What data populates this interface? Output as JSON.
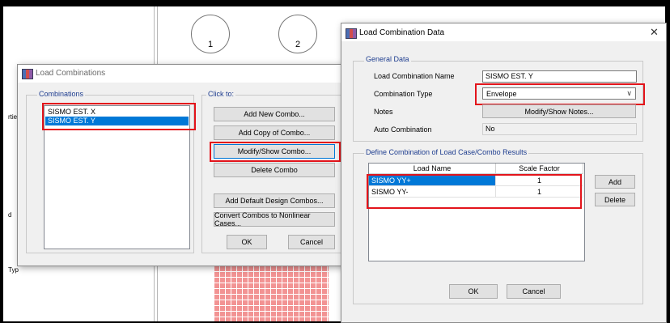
{
  "background": {
    "circles": [
      "1",
      "2"
    ],
    "side_labels": [
      "rtie",
      "d",
      "Typ"
    ]
  },
  "load_combinations": {
    "title": "Load Combinations",
    "combinations_label": "Combinations",
    "combinations": [
      "SISMO EST. X",
      "SISMO EST. Y"
    ],
    "selected_index": 1,
    "click_to_label": "Click to:",
    "buttons": {
      "add_new": "Add New Combo...",
      "add_copy": "Add Copy of Combo...",
      "modify_show": "Modify/Show Combo...",
      "delete": "Delete Combo",
      "add_default": "Add Default Design Combos...",
      "convert": "Convert Combos to Nonlinear Cases...",
      "ok": "OK",
      "cancel": "Cancel"
    }
  },
  "load_combination_data": {
    "title": "Load Combination Data",
    "close": "✕",
    "general_data_label": "General Data",
    "name_label": "Load Combination Name",
    "name_value": "SISMO EST. Y",
    "type_label": "Combination Type",
    "type_value": "Envelope",
    "notes_label": "Notes",
    "notes_button": "Modify/Show Notes...",
    "auto_label": "Auto Combination",
    "auto_value": "No",
    "define_label": "Define Combination of Load Case/Combo Results",
    "col_load_name": "Load Name",
    "col_scale_factor": "Scale Factor",
    "rows": [
      {
        "name": "SISMO YY+",
        "factor": "1"
      },
      {
        "name": "SISMO YY-",
        "factor": "1"
      }
    ],
    "add_button": "Add",
    "delete_button": "Delete",
    "ok_button": "OK",
    "cancel_button": "Cancel"
  },
  "colors": {
    "highlight_red": "#e3141b",
    "selection_blue": "#0078d7",
    "group_label": "#1e3d8f",
    "grid_pink": "#f29393"
  }
}
